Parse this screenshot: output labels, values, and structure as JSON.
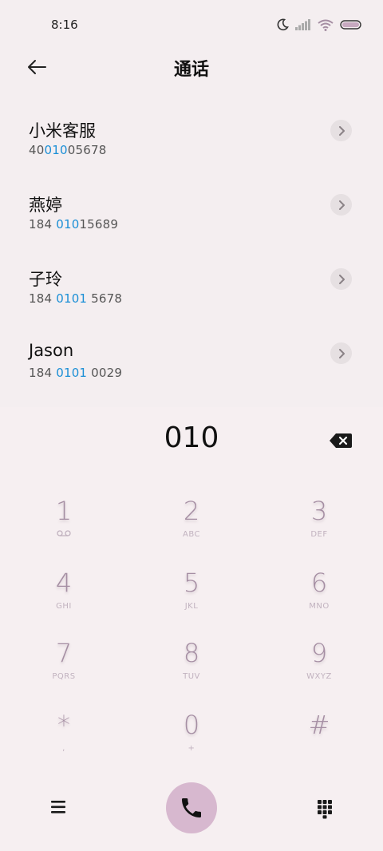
{
  "status": {
    "time": "8:16"
  },
  "header": {
    "title": "通话"
  },
  "contacts": [
    {
      "name": "小米客服",
      "number_pre": "40",
      "number_hl": "010",
      "number_post": "05678"
    },
    {
      "name": "燕婷",
      "number_pre": "184 ",
      "number_hl": "010",
      "number_post": "15689"
    },
    {
      "name": "子玲",
      "number_pre": "184 ",
      "number_hl": "0101",
      "number_post": " 5678"
    },
    {
      "name": "Jason",
      "number_pre": "184 ",
      "number_hl": "0101",
      "number_post": " 0029"
    }
  ],
  "dialer": {
    "input": "010",
    "keys": [
      {
        "digit": "1",
        "letters": ""
      },
      {
        "digit": "2",
        "letters": "ABC"
      },
      {
        "digit": "3",
        "letters": "DEF"
      },
      {
        "digit": "4",
        "letters": "GHI"
      },
      {
        "digit": "5",
        "letters": "JKL"
      },
      {
        "digit": "6",
        "letters": "MNO"
      },
      {
        "digit": "7",
        "letters": "PQRS"
      },
      {
        "digit": "8",
        "letters": "TUV"
      },
      {
        "digit": "9",
        "letters": "WXYZ"
      },
      {
        "digit": "*",
        "letters": ","
      },
      {
        "digit": "0",
        "letters": "+"
      },
      {
        "digit": "#",
        "letters": ""
      }
    ]
  },
  "icons": {
    "status": [
      "moon-icon",
      "signal-icon",
      "wifi-icon",
      "battery-icon"
    ],
    "back": "arrow-left-icon",
    "chevron": "chevron-right-icon",
    "backspace": "backspace-icon",
    "voicemail": "voicemail-icon",
    "menu": "menu-icon",
    "call": "phone-icon",
    "dialpad": "dialpad-icon"
  },
  "colors": {
    "highlight": "#1b8fd6",
    "key_digit": "#a58ea3",
    "call_button": "#d7b8cf"
  }
}
